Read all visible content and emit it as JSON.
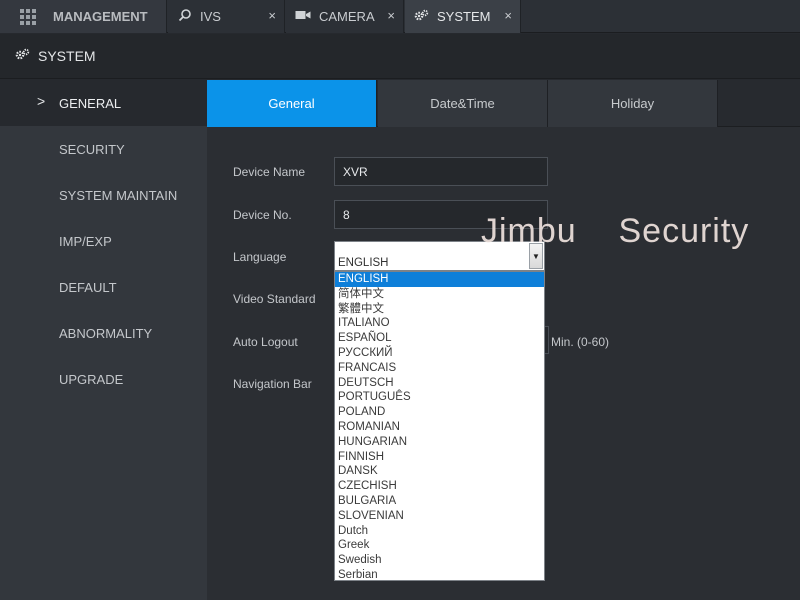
{
  "topbar": {
    "tabs": [
      {
        "label": "MANAGEMENT",
        "icon": "grid-icon"
      },
      {
        "label": "IVS",
        "icon": "ivs-search-icon",
        "close": "×"
      },
      {
        "label": "CAMERA",
        "icon": "camera-icon",
        "close": "×"
      },
      {
        "label": "SYSTEM",
        "icon": "gears-icon",
        "close": "×"
      }
    ]
  },
  "section": {
    "title": "SYSTEM",
    "icon": "gears-icon"
  },
  "sidebar": {
    "items": [
      {
        "label": "GENERAL",
        "active": true
      },
      {
        "label": "SECURITY"
      },
      {
        "label": "SYSTEM MAINTAIN"
      },
      {
        "label": "IMP/EXP"
      },
      {
        "label": "DEFAULT"
      },
      {
        "label": "ABNORMALITY"
      },
      {
        "label": "UPGRADE"
      }
    ]
  },
  "content": {
    "tabs": [
      {
        "label": "General",
        "active": true
      },
      {
        "label": "Date&Time"
      },
      {
        "label": "Holiday"
      }
    ],
    "fields": {
      "device_name": {
        "label": "Device Name",
        "value": "XVR"
      },
      "device_no": {
        "label": "Device No.",
        "value": "8"
      },
      "language": {
        "label": "Language",
        "value": "ENGLISH"
      },
      "video_standard": {
        "label": "Video Standard"
      },
      "auto_logout": {
        "label": "Auto Logout",
        "unit": "Min. (0-60)"
      },
      "navigation_bar": {
        "label": "Navigation Bar"
      }
    },
    "language_options": [
      "ENGLISH",
      "简体中文",
      "繁體中文",
      "ITALIANO",
      "ESPAÑOL",
      "РУССКИЙ",
      "FRANCAIS",
      "DEUTSCH",
      "PORTUGUÊS",
      "POLAND",
      "ROMANIAN",
      "HUNGARIAN",
      "FINNISH",
      "DANSK",
      "CZECHISH",
      "BULGARIA",
      "SLOVENIAN",
      "Dutch",
      "Greek",
      "Swedish",
      "Serbian"
    ],
    "selected_language": "ENGLISH"
  },
  "watermark": "Jimbu    Security",
  "colors": {
    "accent": "#0b93e9",
    "selection": "#0e7fd9"
  }
}
